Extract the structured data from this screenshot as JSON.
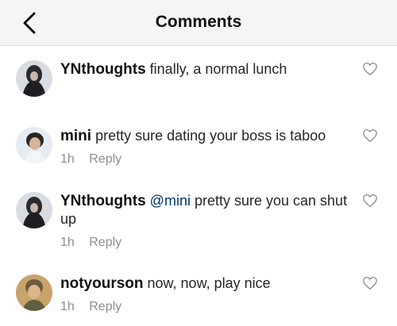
{
  "header": {
    "title": "Comments"
  },
  "comments": [
    {
      "username": "YNthoughts",
      "mention": "",
      "text": "finally, a normal lunch",
      "time": "",
      "reply_label": ""
    },
    {
      "username": "mini",
      "mention": "",
      "text": "pretty sure dating your boss is taboo",
      "time": "1h",
      "reply_label": "Reply"
    },
    {
      "username": "YNthoughts",
      "mention": "@mini",
      "text": "pretty sure you can shut up",
      "time": "1h",
      "reply_label": "Reply"
    },
    {
      "username": "notyourson",
      "mention": "",
      "text": "now, now, play nice",
      "time": "1h",
      "reply_label": "Reply"
    }
  ],
  "colors": {
    "header_bg": "#f5f5f5",
    "meta_text": "#8e8e8e",
    "mention": "#00376b"
  },
  "icons": {
    "back": "chevron-left-icon",
    "like": "heart-outline-icon"
  }
}
